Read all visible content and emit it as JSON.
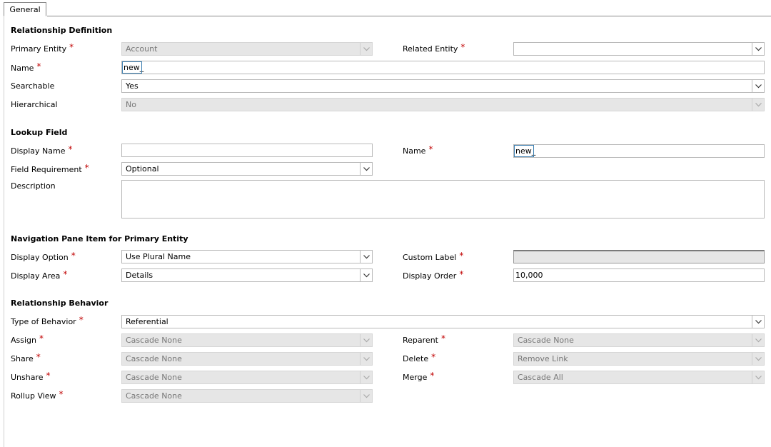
{
  "tab": {
    "label": "General"
  },
  "sections": {
    "relationship_definition": "Relationship Definition",
    "lookup_field": "Lookup Field",
    "navigation_pane": "Navigation Pane Item for Primary Entity",
    "relationship_behavior": "Relationship Behavior"
  },
  "relationship_definition": {
    "primary_entity": {
      "label": "Primary Entity",
      "value": "Account"
    },
    "related_entity": {
      "label": "Related Entity",
      "value": ""
    },
    "name": {
      "label": "Name",
      "value": "new_"
    },
    "searchable": {
      "label": "Searchable",
      "value": "Yes"
    },
    "hierarchical": {
      "label": "Hierarchical",
      "value": "No"
    }
  },
  "lookup_field": {
    "display_name": {
      "label": "Display Name",
      "value": ""
    },
    "name": {
      "label": "Name",
      "value": "new_"
    },
    "field_requirement": {
      "label": "Field Requirement",
      "value": "Optional"
    },
    "description": {
      "label": "Description",
      "value": ""
    }
  },
  "navigation_pane": {
    "display_option": {
      "label": "Display Option",
      "value": "Use Plural Name"
    },
    "custom_label": {
      "label": "Custom Label",
      "value": ""
    },
    "display_area": {
      "label": "Display Area",
      "value": "Details"
    },
    "display_order": {
      "label": "Display Order",
      "value": "10,000"
    }
  },
  "relationship_behavior": {
    "type_of_behavior": {
      "label": "Type of Behavior",
      "value": "Referential"
    },
    "assign": {
      "label": "Assign",
      "value": "Cascade None"
    },
    "reparent": {
      "label": "Reparent",
      "value": "Cascade None"
    },
    "share": {
      "label": "Share",
      "value": "Cascade None"
    },
    "delete": {
      "label": "Delete",
      "value": "Remove Link"
    },
    "unshare": {
      "label": "Unshare",
      "value": "Cascade None"
    },
    "merge": {
      "label": "Merge",
      "value": "Cascade All"
    },
    "rollup_view": {
      "label": "Rollup View",
      "value": "Cascade None"
    }
  },
  "required_marker": "*",
  "colors": {
    "required": "#c00000",
    "disabled_bg": "#e6e6e6",
    "focus_border": "#3c7fb1"
  }
}
